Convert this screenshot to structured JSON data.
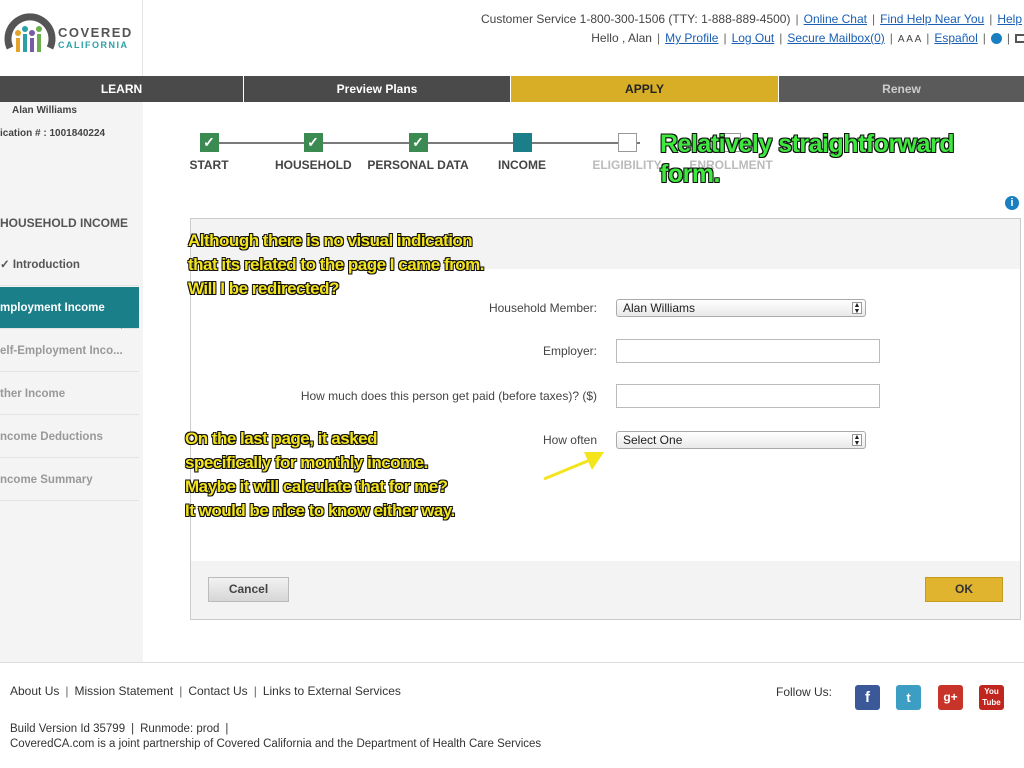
{
  "header": {
    "logo_line1": "COVERED",
    "logo_line2": "CALIFORNIA",
    "customer_service": "Customer Service 1-800-300-1506 (TTY: 1-888-889-4500)",
    "online_chat": "Online Chat",
    "find_help": "Find Help Near You",
    "help": "Help",
    "greeting": "Hello , Alan",
    "my_profile": "My Profile",
    "log_out": "Log Out",
    "secure_mailbox": "Secure Mailbox(0)",
    "font_sizer": "A A A",
    "espanol": "Español"
  },
  "nav": {
    "learn": "LEARN",
    "preview_plans": "Preview Plans",
    "apply": "APPLY",
    "renew": "Renew"
  },
  "sidebar": {
    "name": "Alan Williams",
    "application": "ication # : 1001840224",
    "section": "HOUSEHOLD INCOME",
    "items": [
      {
        "label": "✓ Introduction",
        "state": "done"
      },
      {
        "label": "mployment Income",
        "state": "active"
      },
      {
        "label": "elf-Employment Inco...",
        "state": "pending"
      },
      {
        "label": "ther Income",
        "state": "pending"
      },
      {
        "label": "ncome Deductions",
        "state": "pending"
      },
      {
        "label": "ncome Summary",
        "state": "pending"
      }
    ]
  },
  "steps": [
    {
      "label": "START",
      "state": "done"
    },
    {
      "label": "HOUSEHOLD",
      "state": "done"
    },
    {
      "label": "PERSONAL DATA",
      "state": "done"
    },
    {
      "label": "INCOME",
      "state": "current"
    },
    {
      "label": "ELIGIBILITY",
      "state": "pending"
    },
    {
      "label": "ENROLLMENT",
      "state": "pending"
    }
  ],
  "form": {
    "household_member_label": "Household Member:",
    "household_member_value": "Alan Williams",
    "employer_label": "Employer:",
    "employer_value": "",
    "paid_label": "How much does this person get paid (before taxes)? ($)",
    "paid_value": "",
    "how_often_label": "How often",
    "how_often_value": "Select One",
    "cancel": "Cancel",
    "ok": "OK"
  },
  "annotations": {
    "top_right": [
      "Relatively straightforward",
      "form."
    ],
    "top_left": [
      "Although there is no visual indication",
      "that its related to the page I came from.",
      "Will I be redirected?"
    ],
    "bottom": [
      "On the last page, it asked",
      "specifically for monthly income.",
      "Maybe it will calculate that for me?",
      "It would be nice to know either way."
    ]
  },
  "footer": {
    "links": [
      "About Us",
      "Mission Statement",
      "Contact Us",
      "Links to External Services"
    ],
    "follow_us": "Follow Us:",
    "build": "Build Version Id 35799",
    "runmode": "Runmode: prod",
    "partnership": "CoveredCA.com is a joint partnership of Covered California and the Department of Health Care Services"
  },
  "colors": {
    "teal": "#1b7f8a",
    "apply_gold": "#d9ae27",
    "check_green": "#3a8a52",
    "annotation_yellow": "#f4e41c",
    "annotation_green": "#3ee83e"
  }
}
